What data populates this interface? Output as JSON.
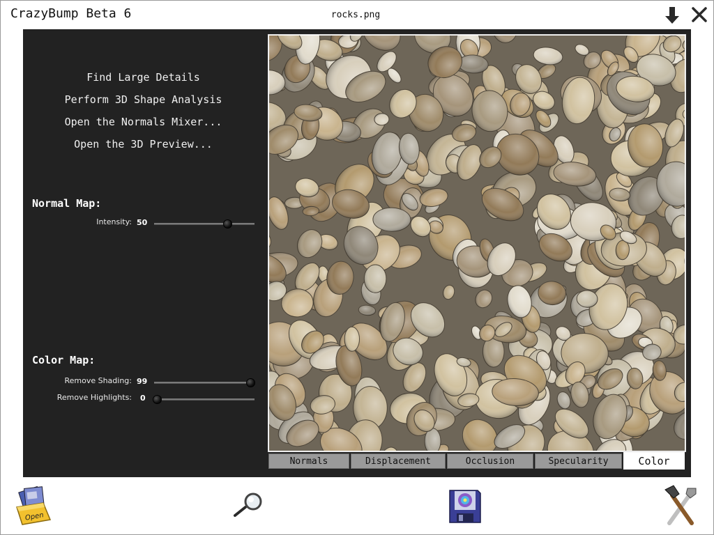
{
  "window": {
    "app_title": "CrazyBump Beta 6",
    "file_name": "rocks.png"
  },
  "actions": [
    "Find Large Details",
    "Perform 3D Shape Analysis",
    "Open the Normals Mixer...",
    "Open the 3D Preview..."
  ],
  "normal_map": {
    "title": "Normal Map:",
    "intensity": {
      "label": "Intensity:",
      "value": "50",
      "fraction": 0.73
    }
  },
  "color_map": {
    "title": "Color Map:",
    "remove_shading": {
      "label": "Remove Shading:",
      "value": "99",
      "fraction": 0.96
    },
    "remove_highlights": {
      "label": "Remove Highlights:",
      "value": "0",
      "fraction": 0.03
    }
  },
  "tabs": [
    "Normals",
    "Displacement",
    "Occlusion",
    "Specularity",
    "Color"
  ],
  "active_tab": "Color",
  "toolbar": {
    "open_label": "Open",
    "icons": [
      "open-folder-icon",
      "magnifier-icon",
      "save-disk-icon",
      "tools-icon"
    ]
  },
  "colors": {
    "workspace": "#222222",
    "tab_inactive": "#9a9a9a",
    "tab_active": "#ffffff"
  }
}
